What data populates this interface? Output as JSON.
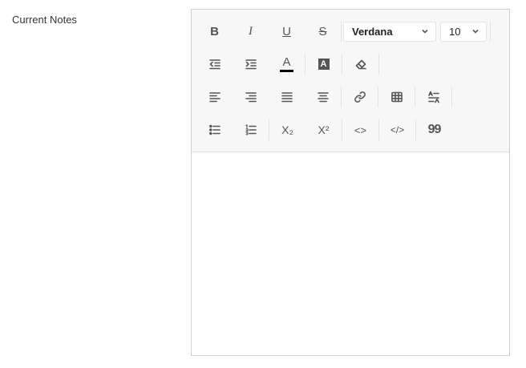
{
  "field": {
    "label": "Current Notes"
  },
  "toolbar": {
    "font_family": "Verdana",
    "font_size": "10",
    "bold_glyph": "B",
    "italic_glyph": "I",
    "underline_glyph": "U",
    "strike_glyph": "S",
    "text_color_glyph": "A",
    "bg_color_glyph": "A",
    "subscript_glyph": "X₂",
    "superscript_glyph": "X²",
    "code_glyph": "<>",
    "codeblock_glyph": "</>",
    "quote_glyph": "99"
  },
  "colors": {
    "text_color_indicator": "#000000",
    "toolbar_bg": "#f7f7f7",
    "border": "#cfcfcf"
  },
  "editor": {
    "content": ""
  }
}
